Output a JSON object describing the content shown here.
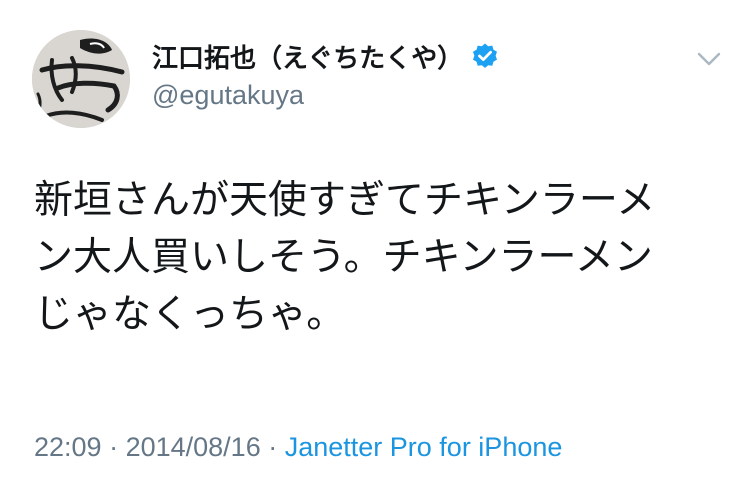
{
  "tweet": {
    "author": {
      "display_name": "江口拓也（えぐちたくや）",
      "handle": "@egutakuya",
      "verified": true,
      "avatar_icon": "avatar-sketch-icon"
    },
    "menu_icon": "chevron-down-icon",
    "text_lines": [
      "新垣さんが天使すぎてチキンラーメ",
      "ン大人買いしそう。チキンラーメン",
      "じゃなくっちゃ。"
    ],
    "meta": {
      "time": "22:09",
      "separator": " · ",
      "date": "2014/08/16",
      "source": "Janetter Pro for iPhone"
    },
    "colors": {
      "text": "#14171a",
      "secondary": "#657786",
      "link": "#1b95e0",
      "verified": "#1da1f2"
    }
  }
}
